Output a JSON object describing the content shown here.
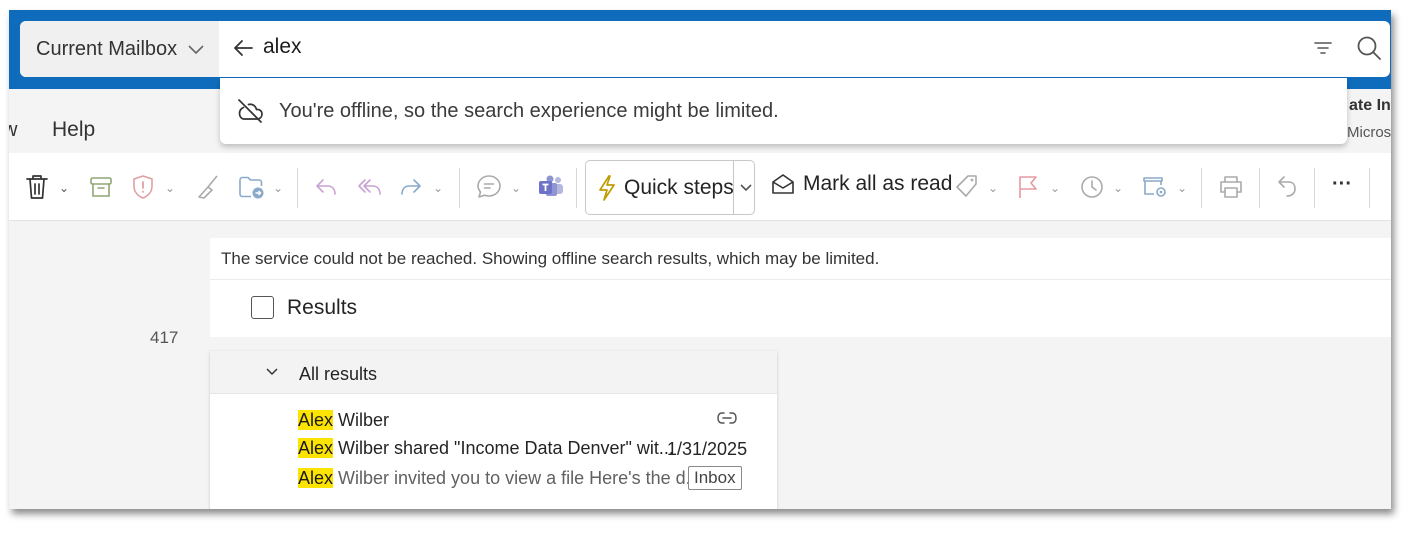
{
  "search": {
    "scope_label": "Current Mailbox",
    "query": "alex",
    "offline_message": "You're offline, so the search experience might be limited."
  },
  "ribbon": {
    "tabs": [
      "w",
      "Help"
    ],
    "right_title": "ate Inc",
    "right_subtitle": "Microsc"
  },
  "toolbar": {
    "quick_steps_label": "Quick steps",
    "mark_all_read_label": "Mark all as read",
    "more_label": "···"
  },
  "left_pane": {
    "count": "417"
  },
  "results": {
    "banner": "The service could not be reached. Showing offline search results, which may be limited.",
    "header_label": "Results",
    "group_label": "All results",
    "items": [
      {
        "highlight": "Alex",
        "line1_rest": " Wilber",
        "line2_rest": " Wilber shared \"Income Data Denver\" wit...",
        "line3_rest": " Wilber invited you to view a file Here's the d...",
        "date": "1/31/2025",
        "folder": "Inbox"
      }
    ]
  },
  "colors": {
    "brand_blue": "#0f6cbd",
    "highlight_yellow": "#fde300",
    "quick_steps_bolt": "#c19c00",
    "flag_red": "#d13438"
  },
  "icons": [
    "chevron-down-icon",
    "back-arrow-icon",
    "filter-icon",
    "search-icon",
    "cloud-offline-icon",
    "delete-icon",
    "archive-icon",
    "report-icon",
    "sweep-icon",
    "move-to-icon",
    "reply-icon",
    "reply-all-icon",
    "forward-icon",
    "chat-icon",
    "teams-icon",
    "bolt-icon",
    "mark-read-icon",
    "tag-icon",
    "flag-icon",
    "snooze-icon",
    "rules-icon",
    "print-icon",
    "undo-icon",
    "more-icon",
    "link-icon"
  ]
}
